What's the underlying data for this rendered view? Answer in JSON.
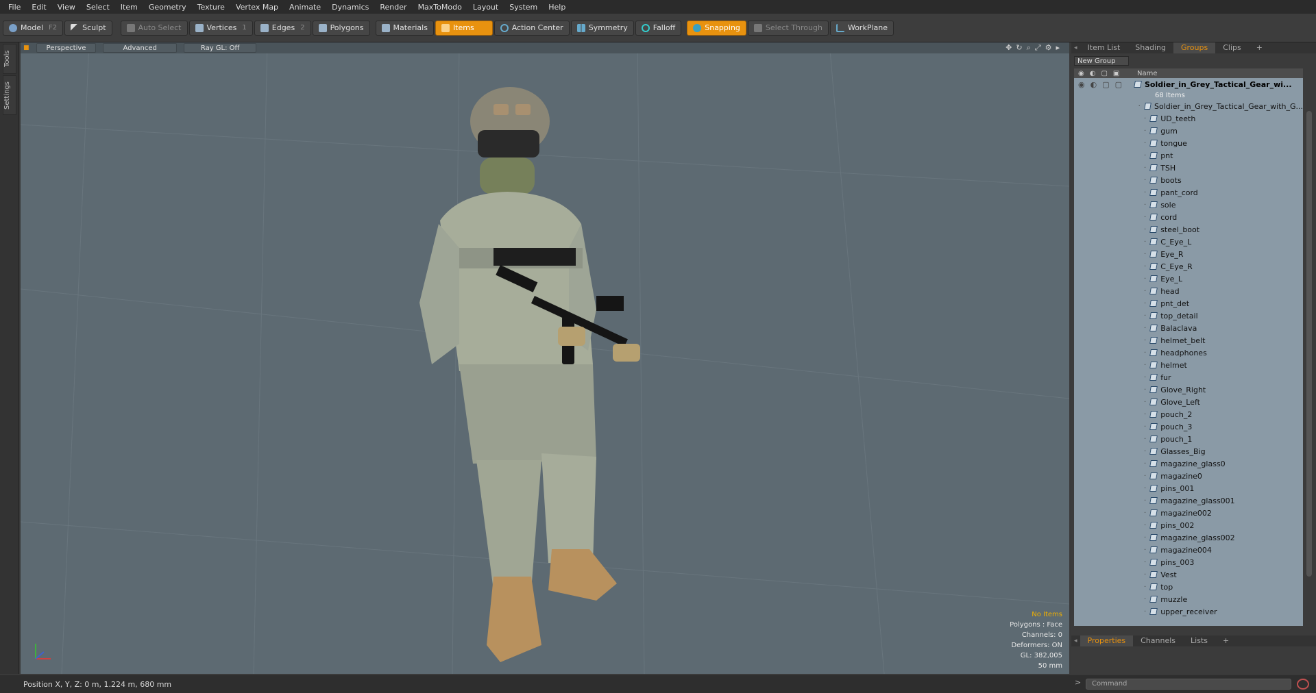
{
  "menu": [
    "File",
    "Edit",
    "View",
    "Select",
    "Item",
    "Geometry",
    "Texture",
    "Vertex Map",
    "Animate",
    "Dynamics",
    "Render",
    "MaxToModo",
    "Layout",
    "System",
    "Help"
  ],
  "toolbar": {
    "model": "Model",
    "model_key": "F2",
    "sculpt": "Sculpt",
    "auto_select": "Auto Select",
    "vertices": "Vertices",
    "vertices_key": "1",
    "edges": "Edges",
    "edges_key": "2",
    "polygons": "Polygons",
    "materials": "Materials",
    "items": "Items",
    "action_center": "Action Center",
    "symmetry": "Symmetry",
    "falloff": "Falloff",
    "snapping": "Snapping",
    "select_through": "Select Through",
    "workplane": "WorkPlane"
  },
  "left_tabs": {
    "tools": "Tools",
    "settings": "Settings"
  },
  "viewport": {
    "perspective": "Perspective",
    "advanced": "Advanced",
    "raygl": "Ray GL: Off",
    "stats": {
      "no_items": "No Items",
      "polygons": "Polygons : Face",
      "channels": "Channels: 0",
      "deformers": "Deformers: ON",
      "gl": "GL: 382,005",
      "lens": "50 mm"
    }
  },
  "panel": {
    "tabs": [
      "Item List",
      "Shading",
      "Groups",
      "Clips",
      "+"
    ],
    "active_tab": "Groups",
    "new_group": "New Group",
    "name_col": "Name",
    "group_name": "Soldier_in_Grey_Tactical_Gear_wi...",
    "group_count": "68 Items",
    "items": [
      "Soldier_in_Grey_Tactical_Gear_with_G...",
      "UD_teeth",
      "gum",
      "tongue",
      "pnt",
      "TSH",
      "boots",
      "pant_cord",
      "sole",
      "cord",
      "steel_boot",
      "C_Eye_L",
      "Eye_R",
      "C_Eye_R",
      "Eye_L",
      "head",
      "pnt_det",
      "top_detail",
      "Balaclava",
      "helmet_belt",
      "headphones",
      "helmet",
      "fur",
      "Glove_Right",
      "Glove_Left",
      "pouch_2",
      "pouch_3",
      "pouch_1",
      "Glasses_Big",
      "magazine_glass0",
      "magazine0",
      "pins_001",
      "magazine_glass001",
      "magazine002",
      "pins_002",
      "magazine_glass002",
      "magazine004",
      "pins_003",
      "Vest",
      "top",
      "muzzle",
      "upper_receiver"
    ],
    "bottom_tabs": [
      "Properties",
      "Channels",
      "Lists",
      "+"
    ]
  },
  "status": {
    "position": "Position X, Y, Z:   0 m, 1.224 m, 680 mm",
    "command": "Command"
  }
}
